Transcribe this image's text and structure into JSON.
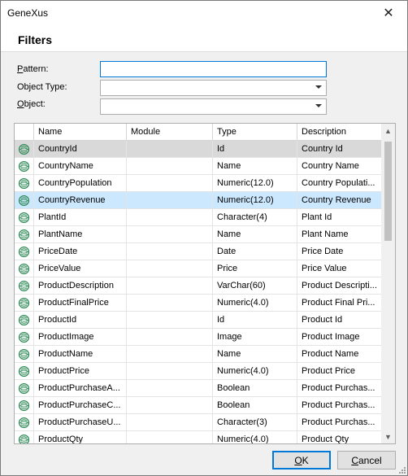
{
  "window": {
    "title": "GeneXus",
    "close_glyph": "✕"
  },
  "header": {
    "title": "Filters"
  },
  "form": {
    "pattern_label_u": "P",
    "pattern_label_rest": "attern:",
    "pattern_value": "",
    "object_type_label": "Object Type:",
    "object_type_value": "",
    "object_label_u": "O",
    "object_label_rest": "bject:",
    "object_value": ""
  },
  "grid": {
    "columns": [
      "Name",
      "Module",
      "Type",
      "Description"
    ],
    "rows": [
      {
        "name": "CountryId",
        "module": "",
        "type": "Id",
        "description": "Country Id",
        "state": "gray"
      },
      {
        "name": "CountryName",
        "module": "",
        "type": "Name",
        "description": "Country Name",
        "state": ""
      },
      {
        "name": "CountryPopulation",
        "module": "",
        "type": "Numeric(12.0)",
        "description": "Country  Populati...",
        "state": ""
      },
      {
        "name": "CountryRevenue",
        "module": "",
        "type": "Numeric(12.0)",
        "description": "Country Revenue",
        "state": "blue"
      },
      {
        "name": "PlantId",
        "module": "",
        "type": "Character(4)",
        "description": "Plant Id",
        "state": ""
      },
      {
        "name": "PlantName",
        "module": "",
        "type": "Name",
        "description": "Plant Name",
        "state": ""
      },
      {
        "name": "PriceDate",
        "module": "",
        "type": "Date",
        "description": "Price Date",
        "state": ""
      },
      {
        "name": "PriceValue",
        "module": "",
        "type": "Price",
        "description": "Price Value",
        "state": ""
      },
      {
        "name": "ProductDescription",
        "module": "",
        "type": "VarChar(60)",
        "description": "Product Descripti...",
        "state": ""
      },
      {
        "name": "ProductFinalPrice",
        "module": "",
        "type": "Numeric(4.0)",
        "description": "Product Final Pri...",
        "state": ""
      },
      {
        "name": "ProductId",
        "module": "",
        "type": "Id",
        "description": "Product Id",
        "state": ""
      },
      {
        "name": "ProductImage",
        "module": "",
        "type": "Image",
        "description": "Product Image",
        "state": ""
      },
      {
        "name": "ProductName",
        "module": "",
        "type": "Name",
        "description": "Product Name",
        "state": ""
      },
      {
        "name": "ProductPrice",
        "module": "",
        "type": "Numeric(4.0)",
        "description": "Product Price",
        "state": ""
      },
      {
        "name": "ProductPurchaseA...",
        "module": "",
        "type": "Boolean",
        "description": "Product Purchas...",
        "state": ""
      },
      {
        "name": "ProductPurchaseC...",
        "module": "",
        "type": "Boolean",
        "description": "Product Purchas...",
        "state": ""
      },
      {
        "name": "ProductPurchaseU...",
        "module": "",
        "type": "Character(3)",
        "description": "Product Purchas...",
        "state": ""
      },
      {
        "name": "ProductQty",
        "module": "",
        "type": "Numeric(4.0)",
        "description": "Product Qty",
        "state": ""
      }
    ],
    "row_icon": "attribute-icon",
    "scroll_up_glyph": "▲",
    "scroll_down_glyph": "▼"
  },
  "buttons": {
    "ok_u": "O",
    "ok_rest": "K",
    "cancel_u": "C",
    "cancel_rest": "ancel"
  },
  "colors": {
    "selection_blue": "#cce8ff",
    "focus_border": "#0078d7",
    "icon_green": "#2e8b57"
  }
}
